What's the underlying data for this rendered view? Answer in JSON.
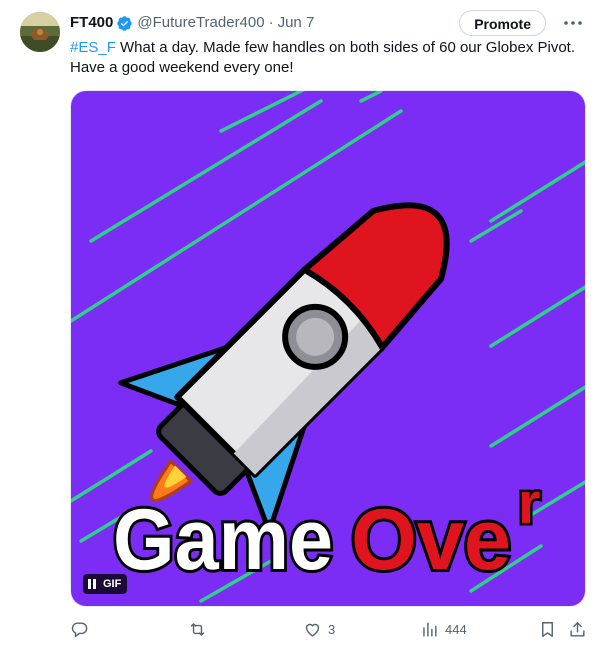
{
  "tweet": {
    "display_name": "FT400",
    "handle": "@FutureTrader400",
    "separator": "·",
    "date": "Jun 7",
    "promote_label": "Promote",
    "text_hashtag": "#ES_F",
    "text_body": " What a day. Made few handles on both sides of 60 our Globex Pivot. Have a good weekend every one!",
    "icons": {
      "verified": "verified-badge-icon",
      "more": "more-icon"
    }
  },
  "media": {
    "type": "gif",
    "gif_label": "GIF",
    "overlay_text_white": "Game",
    "overlay_text_red": "Ove",
    "overlay_text_red_small": "r",
    "colors": {
      "background": "#7b2cf5",
      "stripes": "#2fd08a",
      "rocket_nose": "#e0141e",
      "rocket_fins": "#35a7ea",
      "flame": "#ff7a1a"
    }
  },
  "actions": {
    "reply_count": "",
    "retweet_count": "",
    "like_count": "3",
    "views_count": "444",
    "icons": [
      "reply-icon",
      "retweet-icon",
      "like-icon",
      "views-icon",
      "bookmark-icon",
      "share-icon"
    ]
  },
  "colors": {
    "accent": "#1d9bf0",
    "secondary_text": "#536471"
  }
}
